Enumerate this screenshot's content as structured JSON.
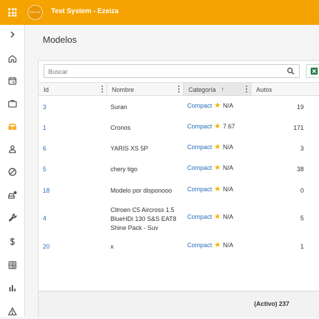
{
  "header": {
    "app_title": "Test System - Ezeiza",
    "logo_text": "RENTEX",
    "accent_color": "#f5a300"
  },
  "sidebar": {
    "items": [
      {
        "icon": "chevron-right-icon"
      },
      {
        "icon": "home-icon"
      },
      {
        "icon": "calendar-icon"
      },
      {
        "icon": "briefcase-icon"
      },
      {
        "icon": "car-icon",
        "active": true
      },
      {
        "icon": "person-icon"
      },
      {
        "icon": "block-icon"
      },
      {
        "icon": "car-alert-icon"
      },
      {
        "icon": "wrench-icon"
      },
      {
        "icon": "dollar-icon"
      },
      {
        "icon": "calculator-icon"
      },
      {
        "icon": "bar-chart-icon"
      },
      {
        "icon": "warning-icon"
      }
    ]
  },
  "page": {
    "title": "Modelos"
  },
  "search": {
    "placeholder": "Buscar",
    "value": ""
  },
  "table": {
    "columns": [
      {
        "label": "Id"
      },
      {
        "label": "Nombre"
      },
      {
        "label": "Categoría",
        "sort": "↑"
      },
      {
        "label": "Autos"
      }
    ],
    "rows": [
      {
        "id": "3",
        "nombre": "Suran",
        "categoria": "Compact",
        "rating": "N/A",
        "autos": "19"
      },
      {
        "id": "1",
        "nombre": "Cronos",
        "categoria": "Compact",
        "rating": "7.67",
        "autos": "171"
      },
      {
        "id": "6",
        "nombre": "YARIS XS 5P",
        "categoria": "Compact",
        "rating": "N/A",
        "autos": "3"
      },
      {
        "id": "5",
        "nombre": "chery tigo",
        "categoria": "Compact",
        "rating": "N/A",
        "autos": "38"
      },
      {
        "id": "18",
        "nombre": "Modelo por disponooo",
        "categoria": "Compact",
        "rating": "N/A",
        "autos": "0"
      },
      {
        "id": "4",
        "nombre": "Citroen C5 Aircross 1.5 BlueHDi 130 S&S EAT8 Shine Pack - Suv",
        "categoria": "Compact",
        "rating": "N/A",
        "autos": "5"
      },
      {
        "id": "20",
        "nombre": "x",
        "categoria": "Compact",
        "rating": "N/A",
        "autos": "1"
      }
    ],
    "footer_total": "(Activo) 237"
  }
}
